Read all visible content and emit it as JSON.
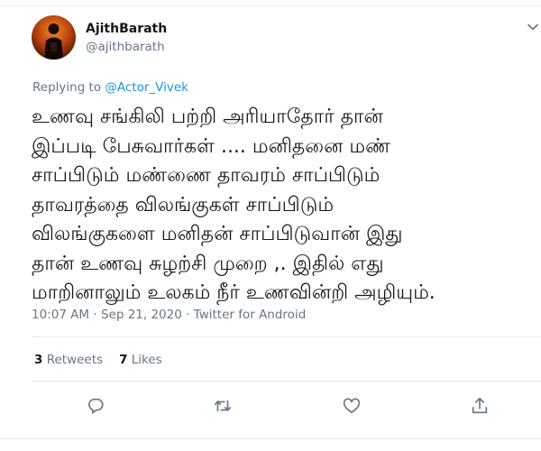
{
  "author": {
    "name": "AjithBarath",
    "handle": "@ajithbarath"
  },
  "reply": {
    "prefix": "Replying to ",
    "mention": "@Actor_Vivek"
  },
  "body_lines": [
    "உணவு சங்கிலி பற்றி அரியாதோர் தான்",
    "இப்படி பேசுவார்கள் .... மனிதனை மண்",
    "சாப்பிடும் மண்ணை தாவரம் சாப்பிடும்",
    "தாவரத்தை விலங்குகள் சாப்பிடும்",
    "விலங்குகளை மனிதன் சாப்பிடுவான் இது",
    "தான் உணவு சுழற்சி முறை ,. இதில் எது",
    "மாறினாலும் உலகம் நீர் உணவின்றி அழியும்."
  ],
  "meta": "10:07 AM · Sep 21, 2020 · Twitter for Android",
  "stats": {
    "retweets_count": "3",
    "retweets_label": "Retweets",
    "likes_count": "7",
    "likes_label": "Likes"
  },
  "icons": {
    "reply": "reply-icon",
    "retweet": "retweet-icon",
    "like": "like-icon",
    "share": "share-icon",
    "caret": "chevron-down-icon"
  },
  "colors": {
    "link": "#1b95e0",
    "secondary_text": "#657786",
    "border": "#e6ecf0"
  }
}
